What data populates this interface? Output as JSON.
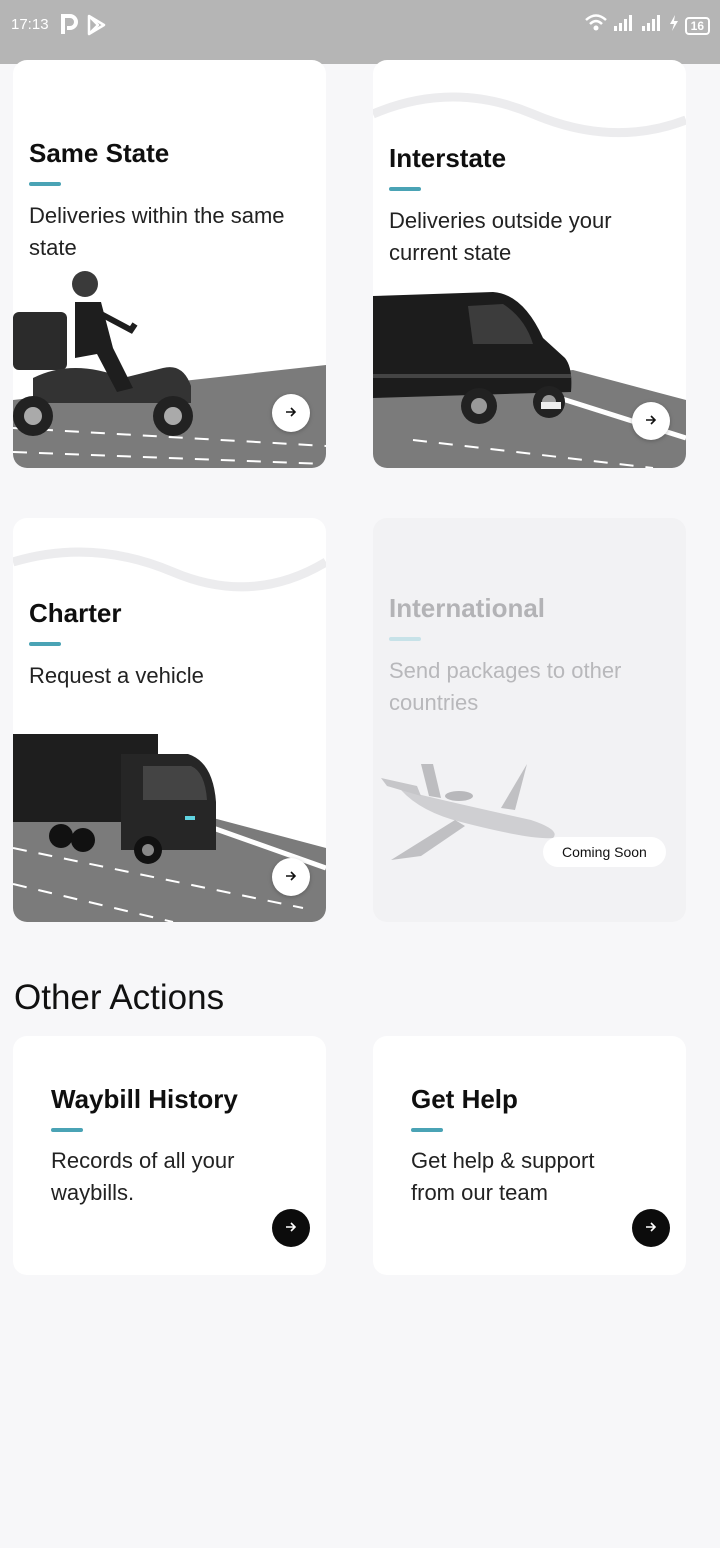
{
  "status_bar": {
    "time": "17:13",
    "battery": "16"
  },
  "services": [
    {
      "title": "Same State",
      "description": "Deliveries within the same state"
    },
    {
      "title": "Interstate",
      "description": "Deliveries outside your current state"
    },
    {
      "title": "Charter",
      "description": "Request a vehicle"
    },
    {
      "title": "International",
      "description": "Send packages to other countries",
      "badge": "Coming Soon"
    }
  ],
  "other_actions": {
    "heading": "Other Actions",
    "items": [
      {
        "title": "Waybill History",
        "description": "Records of all your waybills."
      },
      {
        "title": "Get Help",
        "description": "Get help & support from our team"
      }
    ]
  },
  "colors": {
    "accent": "#4aa3b5",
    "road": "#7b7b7b",
    "background": "#f7f7f9",
    "status_bar": "#b5b5b5"
  }
}
